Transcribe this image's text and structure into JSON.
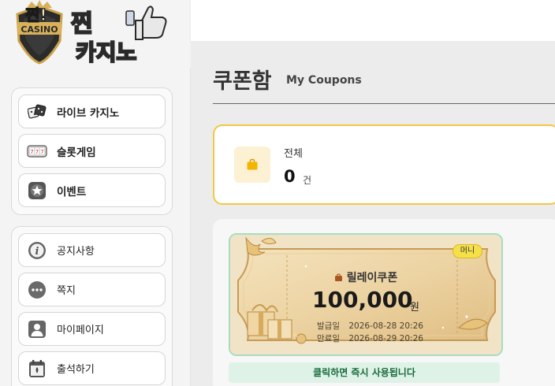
{
  "logo": {
    "badge_text": "찐!",
    "sub_text": "CASINO",
    "main_text": "찐카지노"
  },
  "sidebar": {
    "primary": [
      {
        "label": "라이브 카지노",
        "icon": "dice-icon"
      },
      {
        "label": "슬롯게임",
        "icon": "slot-machine-icon"
      },
      {
        "label": "이벤트",
        "icon": "star-icon"
      }
    ],
    "secondary": [
      {
        "label": "공지사항",
        "icon": "info-icon"
      },
      {
        "label": "쪽지",
        "icon": "message-icon"
      },
      {
        "label": "마이페이지",
        "icon": "user-icon"
      },
      {
        "label": "출석하기",
        "icon": "calendar-icon"
      }
    ]
  },
  "page": {
    "title": "쿠폰함",
    "subtitle": "My Coupons"
  },
  "summary": {
    "label": "전체",
    "count": "0",
    "unit": "건",
    "icon": "bag-icon"
  },
  "coupon": {
    "badge": "머니",
    "name": "릴레이쿠폰",
    "amount": "100,000",
    "currency": "원",
    "issued_label": "발급일",
    "issued_value": "2026-08-28 20:26",
    "expires_label": "만료일",
    "expires_value": "2026-08-29 20:26",
    "action_text": "클릭하면 즉시 사용됩니다"
  },
  "colors": {
    "accent_yellow": "#f2c744",
    "green_border": "#a8dcc0",
    "green_text": "#176b3c"
  }
}
